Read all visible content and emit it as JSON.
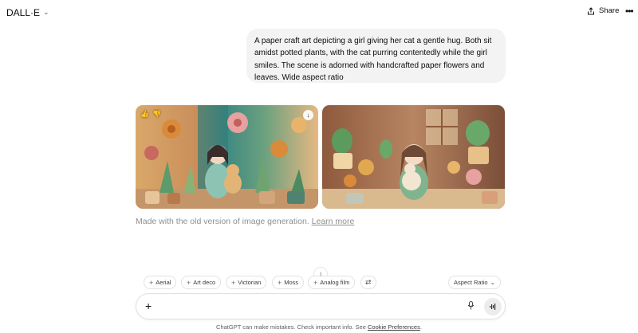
{
  "header": {
    "app_title": "DALL·E",
    "share_label": "Share",
    "more_icon": "more-dots-icon"
  },
  "conversation": {
    "user_message": "A paper craft art depicting a girl giving her cat a gentle hug. Both sit amidst potted plants, with the cat purring contentedly while the girl smiles. The scene is adorned with handcrafted paper flowers and leaves. Wide aspect ratio",
    "images": [
      {
        "icons": [
          "thumbs-up-icon",
          "thumbs-down-icon",
          "download-icon"
        ]
      },
      {
        "icons": []
      }
    ],
    "made_with_text": "Made with the old version of image generation.",
    "learn_more_label": "Learn more"
  },
  "style_chips": [
    {
      "label": "Aerial"
    },
    {
      "label": "Art deco"
    },
    {
      "label": "Victorian"
    },
    {
      "label": "Moss"
    },
    {
      "label": "Analog film"
    }
  ],
  "shuffle_icon": "shuffle-icon",
  "aspect_ratio_label": "Aspect Ratio",
  "composer": {
    "placeholder": "",
    "value": ""
  },
  "footer": {
    "disclaimer": "ChatGPT can make mistakes. Check important info. See",
    "link_label": "Cookie Preferences",
    "end": "."
  },
  "colors": {
    "bubble_bg": "#f3f3f3",
    "muted_text": "#8f8f8f",
    "border": "#e3e3e3"
  }
}
